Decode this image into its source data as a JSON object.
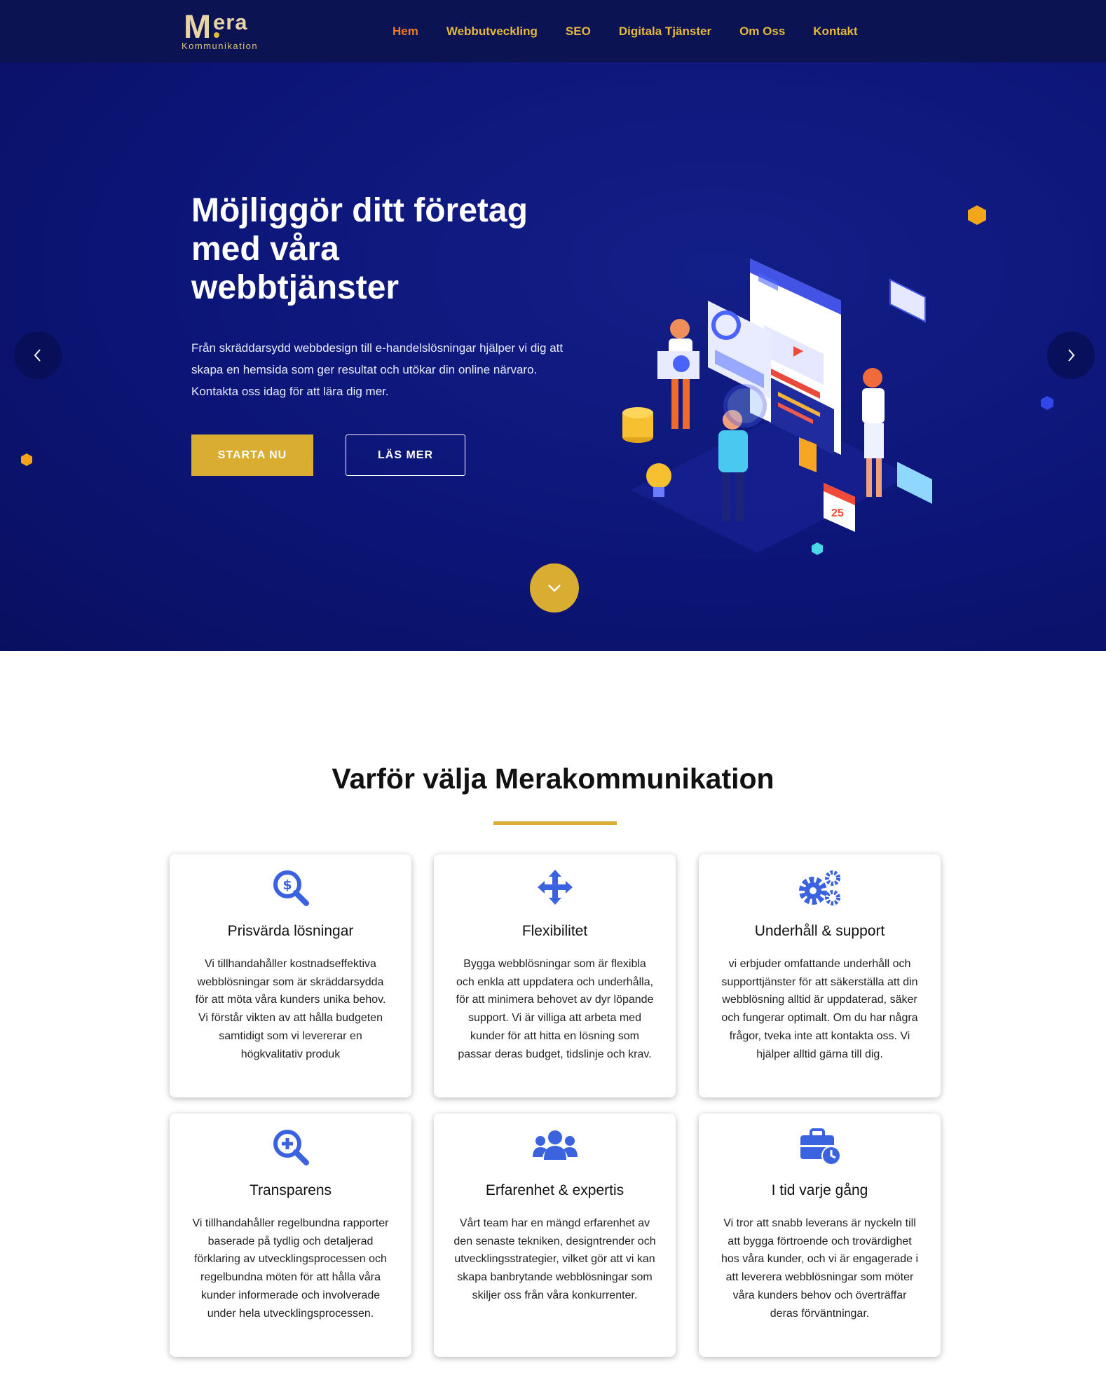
{
  "header": {
    "logo": {
      "initial": "M",
      "rest": "era",
      "subtitle": "Kommunikation"
    },
    "nav": [
      {
        "label": "Hem",
        "active": true
      },
      {
        "label": "Webbutveckling"
      },
      {
        "label": "SEO"
      },
      {
        "label": "Digitala Tjänster"
      },
      {
        "label": "Om Oss"
      },
      {
        "label": "Kontakt"
      }
    ]
  },
  "hero": {
    "title": "Möjliggör ditt företag med våra webbtjänster",
    "text": "Från skräddarsydd webbdesign till e-handelslösningar hjälper vi dig att skapa en hemsida som ger resultat och utökar din online närvaro. Kontakta oss idag för att lära dig mer.",
    "primary_button": "STARTA NU",
    "secondary_button": "LÄS MER",
    "illustration_calendar_day": "25"
  },
  "features": {
    "title": "Varför välja Merakommunikation",
    "cards": [
      {
        "icon": "search-dollar-icon",
        "title": "Prisvärda lösningar",
        "text": "Vi tillhandahåller kostnadseffektiva webblösningar som är skräddarsydda för att möta våra kunders unika behov. Vi förstår vikten av att hålla budgeten samtidigt som vi levererar en högkvalitativ produk"
      },
      {
        "icon": "arrows-move-icon",
        "title": "Flexibilitet",
        "text": "Bygga webblösningar som är flexibla och enkla att uppdatera och underhålla, för att minimera behovet av dyr löpande support. Vi är villiga att arbeta med kunder för att hitta en lösning som passar deras budget, tidslinje och krav."
      },
      {
        "icon": "gears-icon",
        "title": "Underhåll & support",
        "text": "vi erbjuder omfattande underhåll och supporttjänster för att säkerställa att din webblösning alltid är uppdaterad, säker och fungerar optimalt. Om du har några frågor, tveka inte att kontakta oss. Vi hjälper alltid gärna till dig."
      },
      {
        "icon": "search-plus-icon",
        "title": "Transparens",
        "text": "Vi tillhandahåller regelbundna rapporter baserade på tydlig och detaljerad förklaring av utvecklingsprocessen och regelbundna möten för att hålla våra kunder informerade och involverade under hela utvecklingsprocessen."
      },
      {
        "icon": "users-icon",
        "title": "Erfarenhet & expertis",
        "text": "Vårt team har en mängd erfarenhet av den senaste tekniken, designtrender och utvecklingsstrategier, vilket gör att vi kan skapa banbrytande webblösningar som skiljer oss från våra konkurrenter."
      },
      {
        "icon": "briefcase-clock-icon",
        "title": "I tid varje gång",
        "text": "Vi tror att snabb leverans är nyckeln till att bygga förtroende och trovärdighet hos våra kunder, och vi är engagerade i att leverera webblösningar som möter våra kunders behov och överträffar deras förväntningar."
      }
    ]
  },
  "colors": {
    "header_bg": "#0b1353",
    "hero_bg": "#0c1577",
    "accent_gold": "#d9ac32",
    "nav_active": "#f07a2a",
    "icon_blue": "#3b63e0"
  }
}
